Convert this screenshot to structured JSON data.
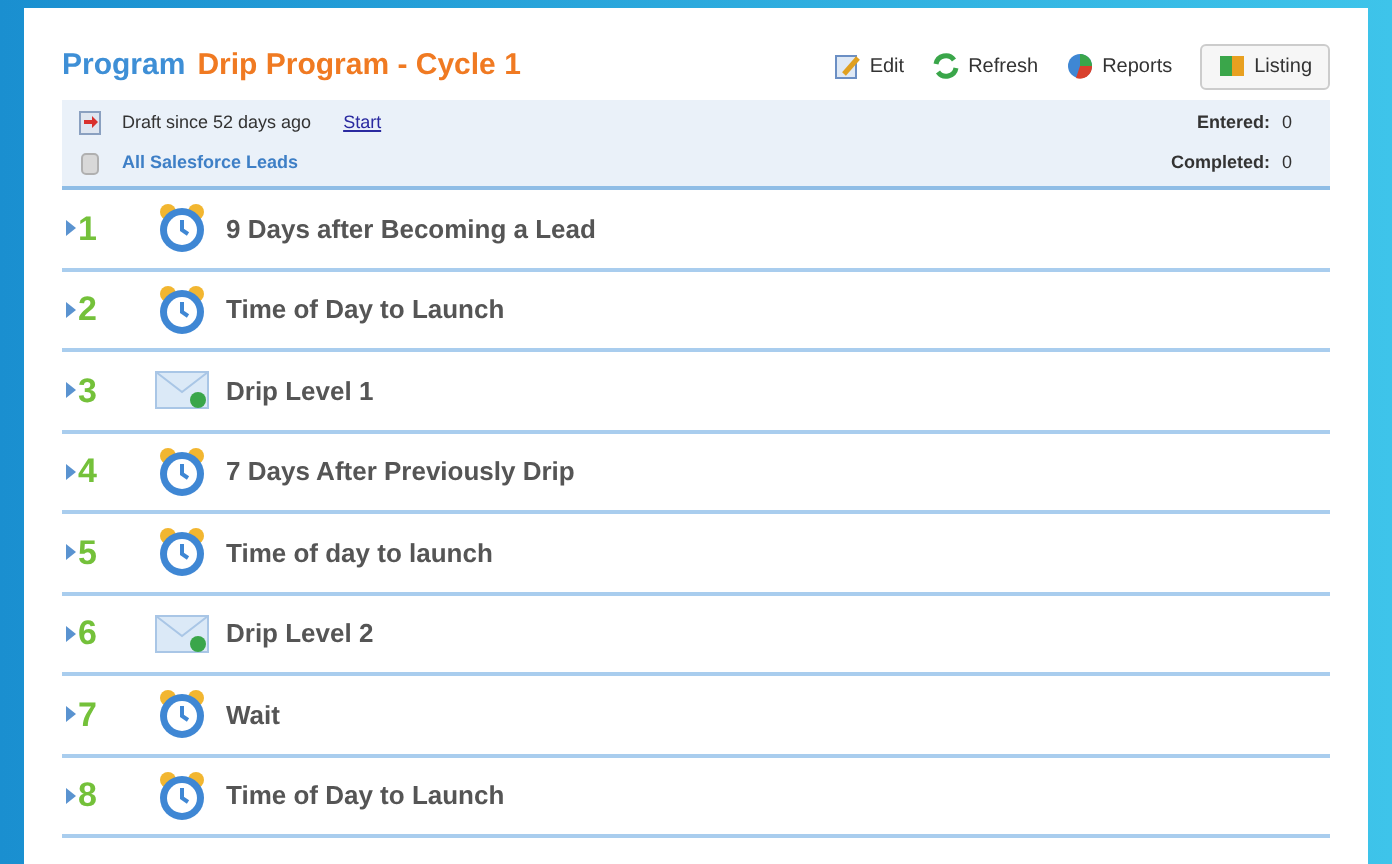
{
  "header": {
    "label": "Program",
    "name": "Drip Program - Cycle 1"
  },
  "toolbar": [
    {
      "label": "Edit",
      "kind": "edit"
    },
    {
      "label": "Refresh",
      "kind": "refresh"
    },
    {
      "label": "Reports",
      "kind": "reports"
    },
    {
      "label": "Listing",
      "kind": "listing"
    }
  ],
  "info": {
    "status": "Draft since 52 days ago",
    "start_link": "Start",
    "list": "All Salesforce Leads",
    "stats": [
      {
        "label": "Entered:",
        "value": "0"
      },
      {
        "label": "Completed:",
        "value": "0"
      }
    ]
  },
  "steps": [
    {
      "number": "1",
      "kind": "wait",
      "title": "9 Days after Becoming a Lead"
    },
    {
      "number": "2",
      "kind": "wait",
      "title": "Time of Day to Launch"
    },
    {
      "number": "3",
      "kind": "email",
      "title": "Drip Level 1"
    },
    {
      "number": "4",
      "kind": "wait",
      "title": "7 Days After Previously Drip"
    },
    {
      "number": "5",
      "kind": "wait",
      "title": "Time of day to launch"
    },
    {
      "number": "6",
      "kind": "email",
      "title": "Drip Level 2"
    },
    {
      "number": "7",
      "kind": "wait",
      "title": "Wait"
    },
    {
      "number": "8",
      "kind": "wait",
      "title": "Time of Day to Launch"
    }
  ]
}
